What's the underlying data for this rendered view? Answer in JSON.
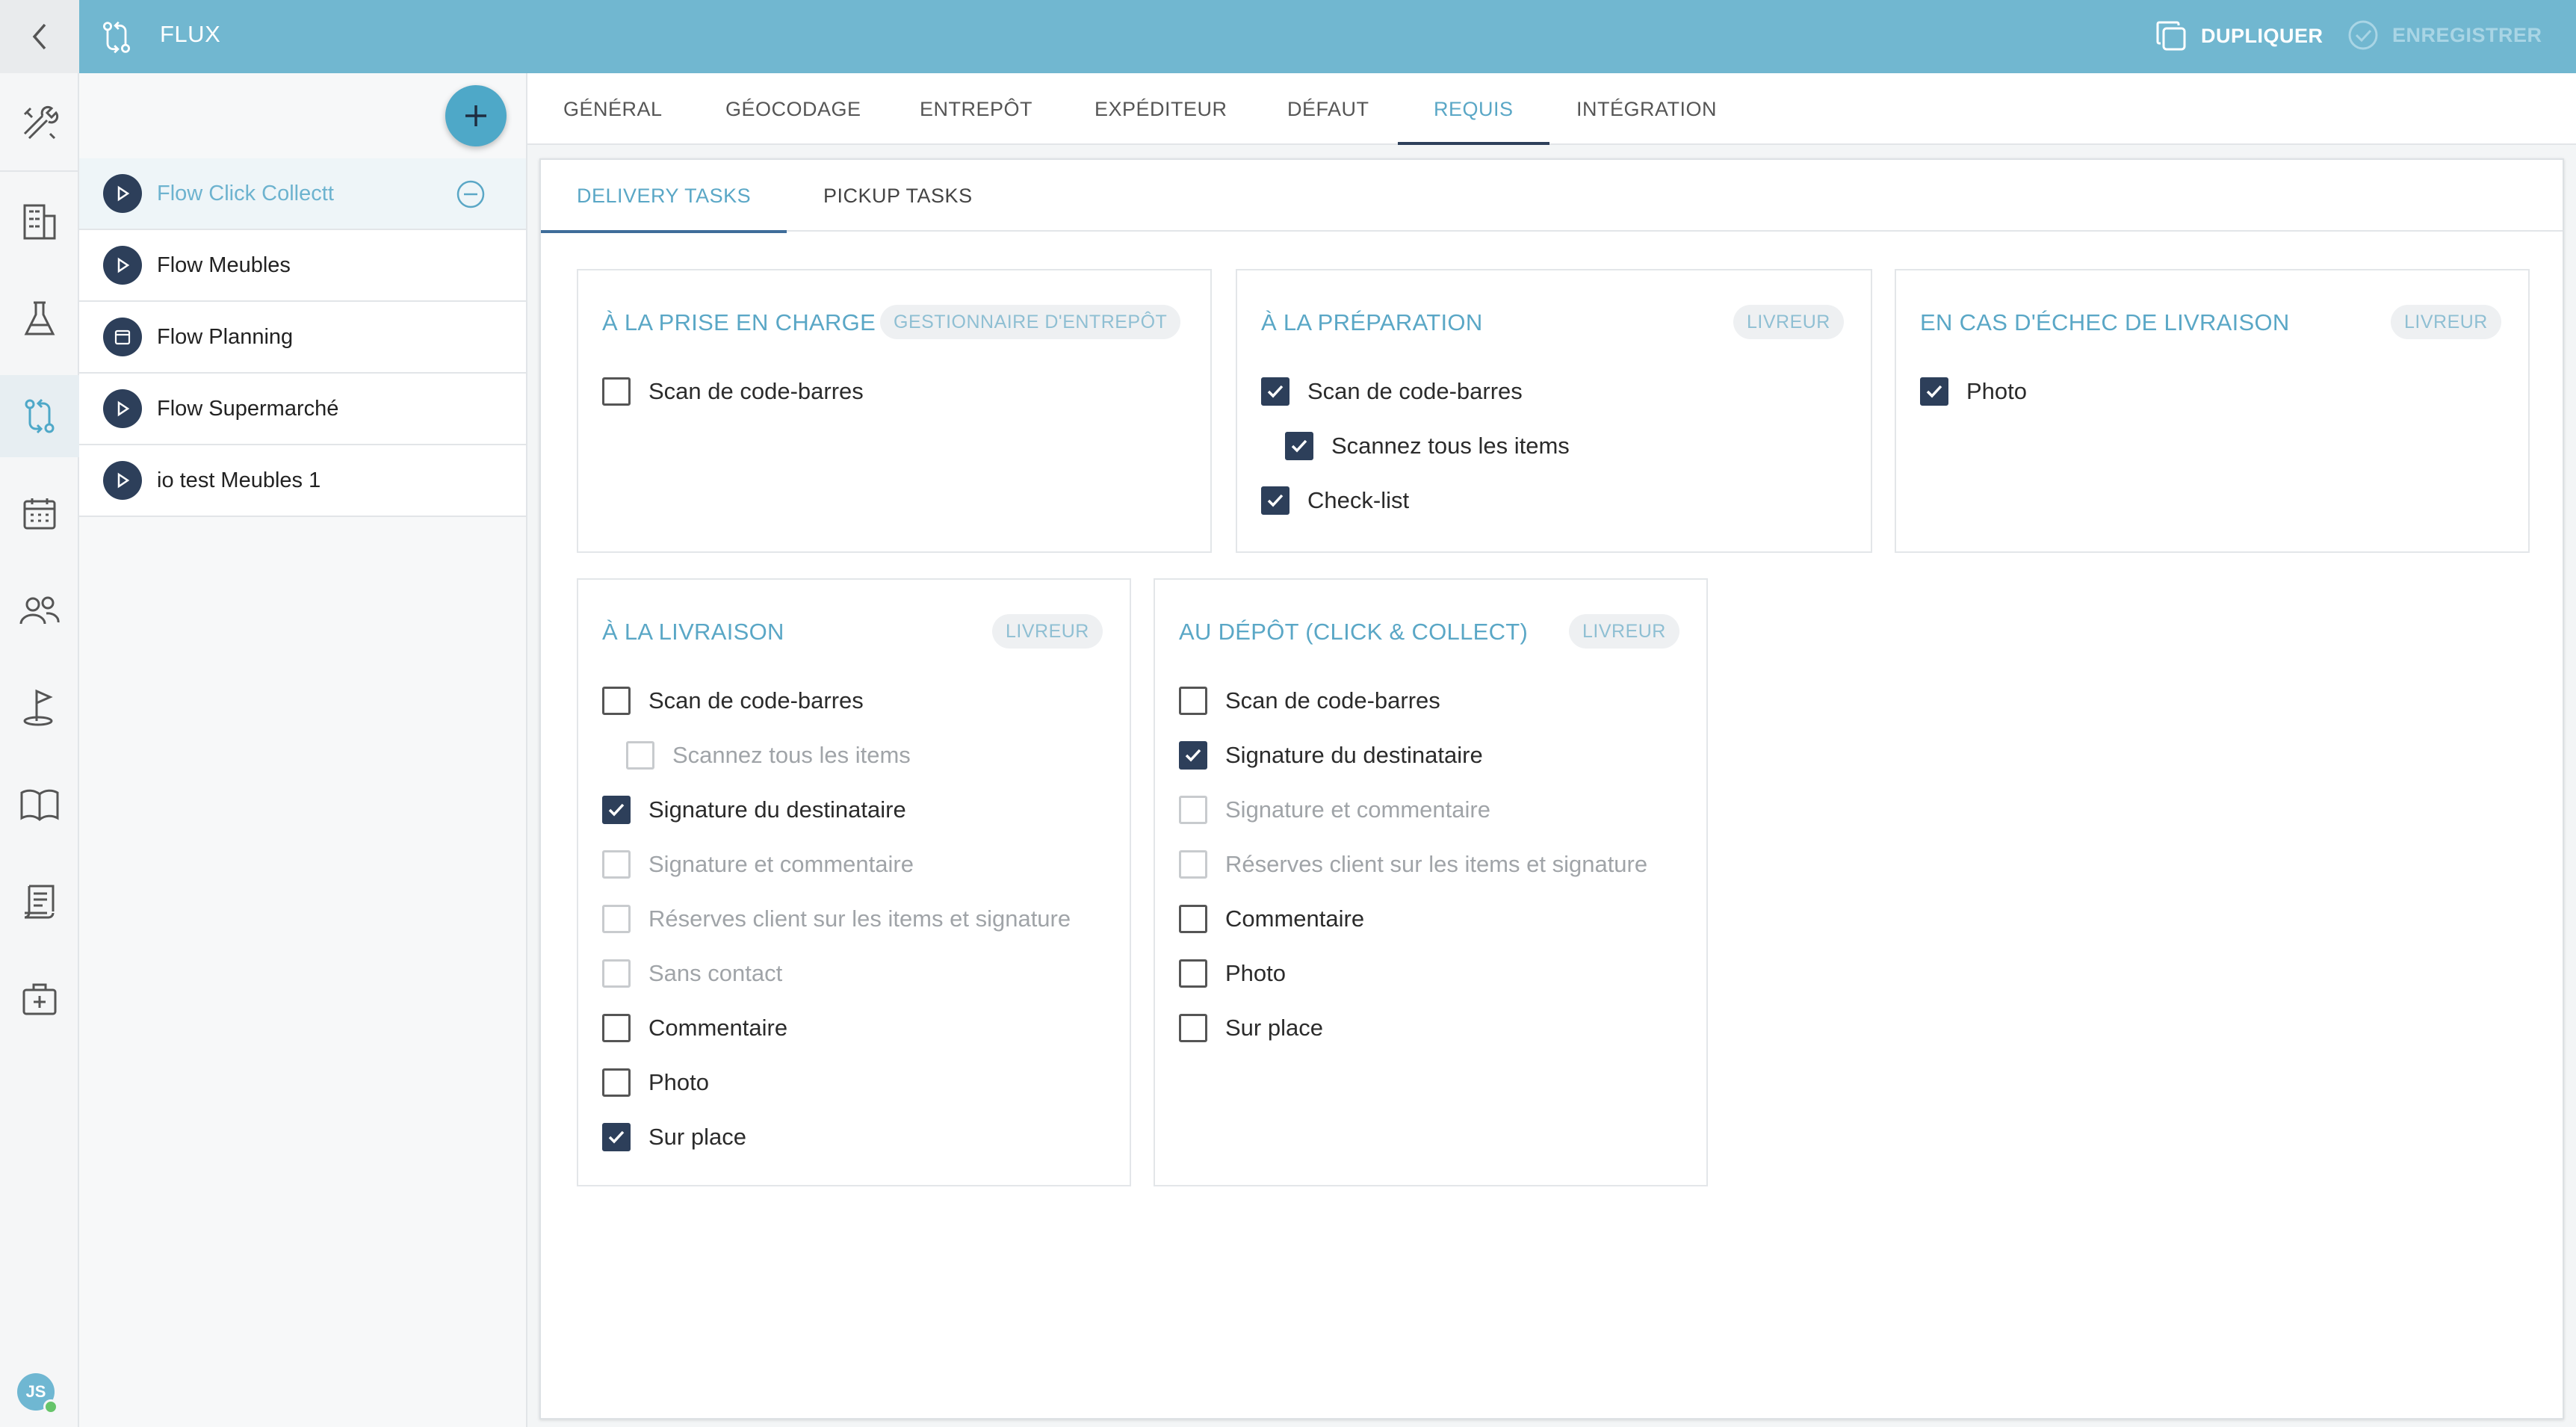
{
  "topbar": {
    "title": "FLUX",
    "duplicate_label": "DUPLIQUER",
    "save_label": "ENREGISTRER"
  },
  "flows": [
    {
      "name": "Flow Click Collectt",
      "icon": "play-icon",
      "selected": true
    },
    {
      "name": "Flow Meubles",
      "icon": "play-icon"
    },
    {
      "name": "Flow Planning",
      "icon": "calendar-icon"
    },
    {
      "name": "Flow Supermarché",
      "icon": "play-icon"
    },
    {
      "name": "io test Meubles 1",
      "icon": "play-icon"
    }
  ],
  "tabs": [
    "GÉNÉRAL",
    "GÉOCODAGE",
    "ENTREPÔT",
    "EXPÉDITEUR",
    "DÉFAUT",
    "REQUIS",
    "INTÉGRATION"
  ],
  "active_tab": "REQUIS",
  "subtabs": [
    "DELIVERY TASKS",
    "PICKUP TASKS"
  ],
  "active_subtab": "DELIVERY TASKS",
  "cards": {
    "pickup": {
      "title": "À LA PRISE EN CHARGE",
      "badge": "GESTIONNAIRE D'ENTREPÔT",
      "options": [
        {
          "label": "Scan de code-barres",
          "checked": false
        }
      ]
    },
    "preparation": {
      "title": "À LA PRÉPARATION",
      "badge": "LIVREUR",
      "options": [
        {
          "label": "Scan de code-barres",
          "checked": true
        },
        {
          "label": "Scannez tous les items",
          "checked": true,
          "indent": true
        },
        {
          "label": "Check-list",
          "checked": true
        }
      ]
    },
    "failure": {
      "title": "EN CAS D'ÉCHEC DE LIVRAISON",
      "badge": "LIVREUR",
      "options": [
        {
          "label": "Photo",
          "checked": true
        }
      ]
    },
    "delivery": {
      "title": "À LA LIVRAISON",
      "badge": "LIVREUR",
      "options": [
        {
          "label": "Scan de code-barres",
          "checked": false
        },
        {
          "label": "Scannez tous les items",
          "checked": false,
          "indent": true,
          "disabled": true
        },
        {
          "label": "Signature du destinataire",
          "checked": true
        },
        {
          "label": "Signature et commentaire",
          "checked": false,
          "disabled": true
        },
        {
          "label": "Réserves client sur les items et signature",
          "checked": false,
          "disabled": true
        },
        {
          "label": "Sans contact",
          "checked": false,
          "disabled": true
        },
        {
          "label": "Commentaire",
          "checked": false
        },
        {
          "label": "Photo",
          "checked": false
        },
        {
          "label": "Sur place",
          "checked": true
        }
      ]
    },
    "dropoff": {
      "title": "AU DÉPÔT (CLICK & COLLECT)",
      "badge": "LIVREUR",
      "options": [
        {
          "label": "Scan de code-barres",
          "checked": false
        },
        {
          "label": "Signature du destinataire",
          "checked": true
        },
        {
          "label": "Signature et commentaire",
          "checked": false,
          "disabled": true
        },
        {
          "label": "Réserves client sur les items et signature",
          "checked": false,
          "disabled": true
        },
        {
          "label": "Commentaire",
          "checked": false
        },
        {
          "label": "Photo",
          "checked": false
        },
        {
          "label": "Sur place",
          "checked": false
        }
      ]
    }
  },
  "user": {
    "initials": "JS"
  },
  "colors": {
    "topbar": "#71b7d0",
    "accent": "#5aa7c6",
    "navy": "#2d3f5a"
  }
}
